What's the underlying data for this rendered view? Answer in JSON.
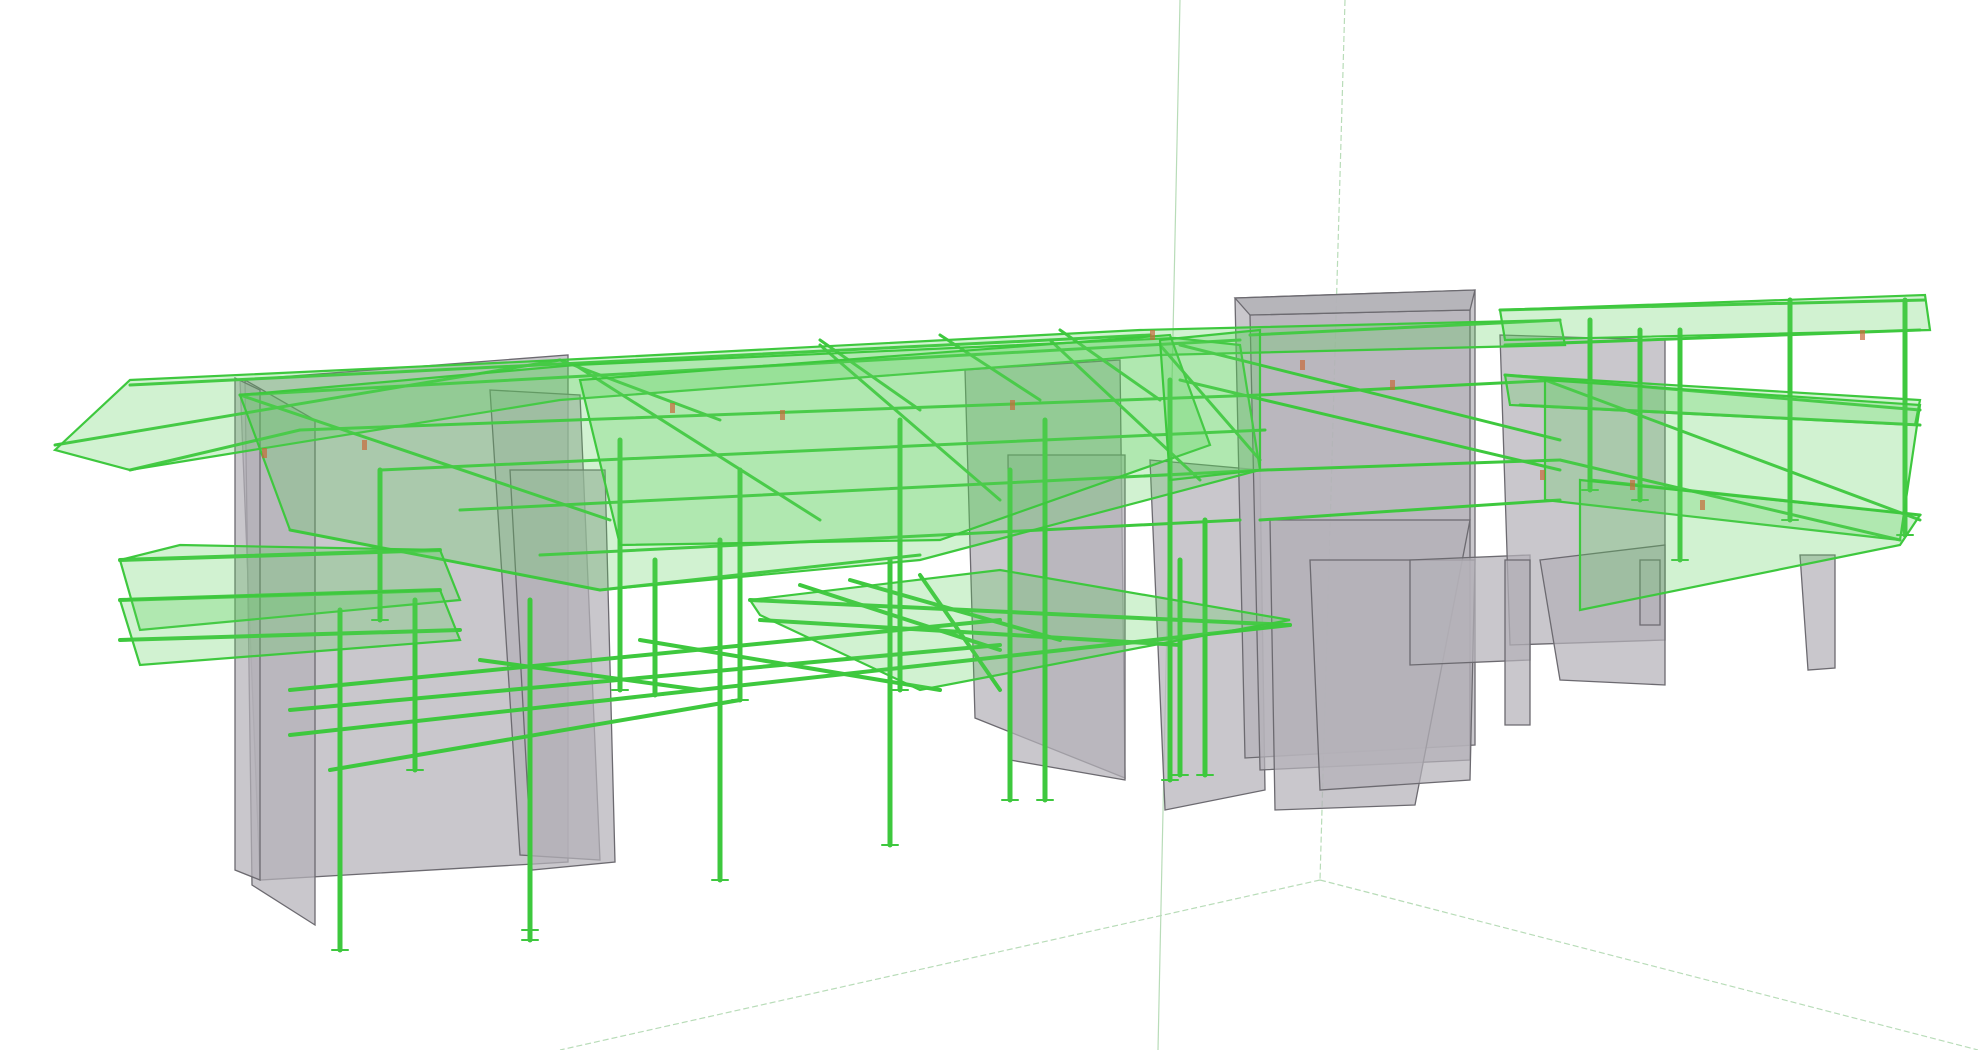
{
  "viewport": {
    "background": "#ffffff",
    "steel_color": "#3ec83e",
    "steel_fill": "#5ad05a",
    "concrete_fill": "#b4b2b8",
    "concrete_stroke": "#6c6a70",
    "guide_line_color": "#b8dcb8"
  }
}
